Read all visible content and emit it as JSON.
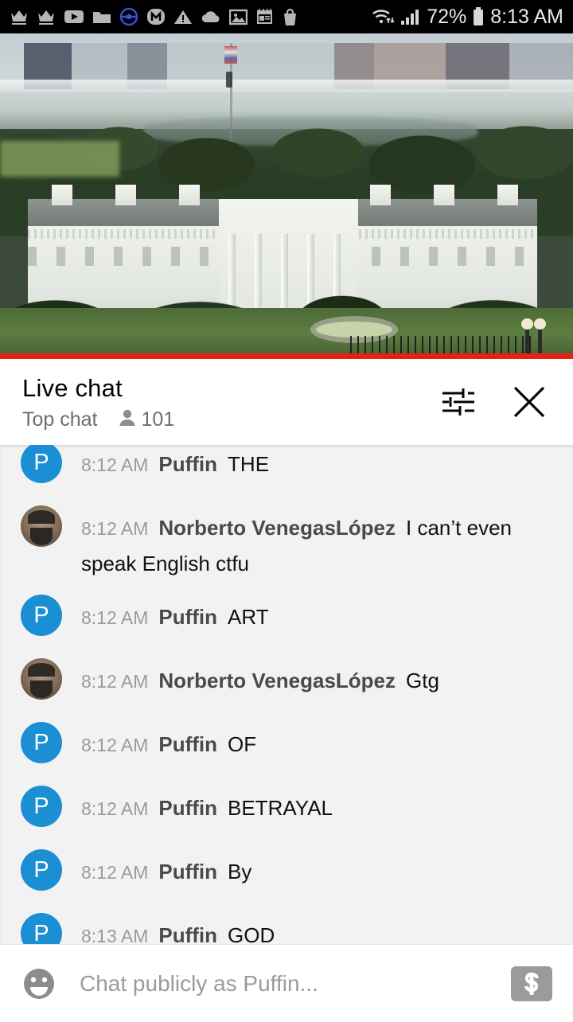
{
  "status_bar": {
    "time": "8:13 AM",
    "battery_percent": "72%",
    "left_icons": [
      "crown-icon",
      "crown-icon",
      "youtube-icon",
      "folder-icon",
      "pokeball-icon",
      "m-app-icon",
      "warning-triangle-icon",
      "cloud-icon",
      "photo-icon",
      "calendar-icon",
      "shopping-bag-icon"
    ],
    "right_icons": [
      "wifi-icon",
      "signal-icon",
      "battery-icon"
    ]
  },
  "video": {
    "progress_color": "#e62117",
    "description": "white-house-livestream-frame"
  },
  "chat_header": {
    "title": "Live chat",
    "mode": "Top chat",
    "viewer_count": "101",
    "settings_label": "chat-settings",
    "close_label": "close"
  },
  "messages": [
    {
      "time": "8:12 AM",
      "author": "Puffin",
      "text": "THE",
      "avatar_type": "letter",
      "avatar_letter": "P",
      "avatar_color": "#1a8fd4"
    },
    {
      "time": "8:12 AM",
      "author": "Norberto VenegasLópez",
      "text": "I can’t even speak English ctfu",
      "avatar_type": "photo",
      "avatar_letter": "",
      "avatar_color": "#8d7660"
    },
    {
      "time": "8:12 AM",
      "author": "Puffin",
      "text": "ART",
      "avatar_type": "letter",
      "avatar_letter": "P",
      "avatar_color": "#1a8fd4"
    },
    {
      "time": "8:12 AM",
      "author": "Norberto VenegasLópez",
      "text": "Gtg",
      "avatar_type": "photo",
      "avatar_letter": "",
      "avatar_color": "#8d7660"
    },
    {
      "time": "8:12 AM",
      "author": "Puffin",
      "text": "OF",
      "avatar_type": "letter",
      "avatar_letter": "P",
      "avatar_color": "#1a8fd4"
    },
    {
      "time": "8:12 AM",
      "author": "Puffin",
      "text": "BETRAYAL",
      "avatar_type": "letter",
      "avatar_letter": "P",
      "avatar_color": "#1a8fd4"
    },
    {
      "time": "8:12 AM",
      "author": "Puffin",
      "text": "By",
      "avatar_type": "letter",
      "avatar_letter": "P",
      "avatar_color": "#1a8fd4"
    },
    {
      "time": "8:13 AM",
      "author": "Puffin",
      "text": "GOD",
      "avatar_type": "letter",
      "avatar_letter": "P",
      "avatar_color": "#1a8fd4"
    }
  ],
  "input_bar": {
    "placeholder": "Chat publicly as Puffin...",
    "value": "",
    "emoji_icon": "smiley-icon",
    "superchat_icon": "dollar-icon"
  }
}
